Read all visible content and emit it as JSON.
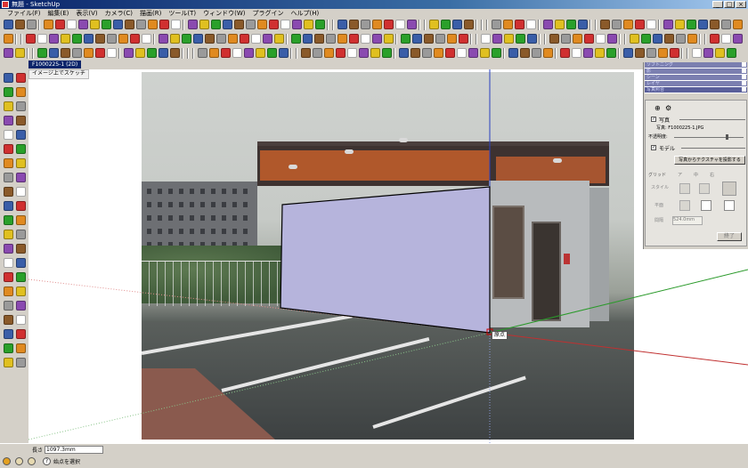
{
  "window": {
    "title": "無題 - SketchUp",
    "minimize": "_",
    "maximize": "□",
    "close": "×"
  },
  "menubar": [
    "ファイル(F)",
    "編集(E)",
    "表示(V)",
    "カメラ(C)",
    "描画(R)",
    "ツール(T)",
    "ウィンドウ(W)",
    "プラグイン",
    "ヘルプ(H)"
  ],
  "toolbar_colors": {
    "accent": "#3a5ea8",
    "green": "#2aa02a",
    "red": "#d03030",
    "orange": "#e08a20",
    "yellow": "#e0c020",
    "gray": "#9a9a9a",
    "purple": "#8a4ab0",
    "brown": "#8a5a2a"
  },
  "doc_tab": "F1000225-1 (2D)",
  "scene_tab": "イメージ上でスケッチ",
  "selection_label": "原点",
  "tray": {
    "bars": [
      "ソフトニング",
      "影",
      "シーン",
      "レイヤ",
      "写真照合"
    ],
    "photo_checkbox_label": "写真",
    "photo_file_label": "写真: F1000225-1.JPG",
    "opacity_label": "不透明度:",
    "model_checkbox_label": "モデル",
    "project_button": "写真からテクスチャを投影する",
    "grid_label": "グリッド",
    "grid_style_label": "スタイル",
    "grid_options": [
      "ア",
      "中",
      "右"
    ],
    "plane_label": "平面",
    "spacing_label": "間隔",
    "spacing_value": "524.0mm",
    "done_button": "終了"
  },
  "status": {
    "measure_label": "長さ",
    "measure_value": "1097.3mm",
    "hint": "始点を選択"
  }
}
